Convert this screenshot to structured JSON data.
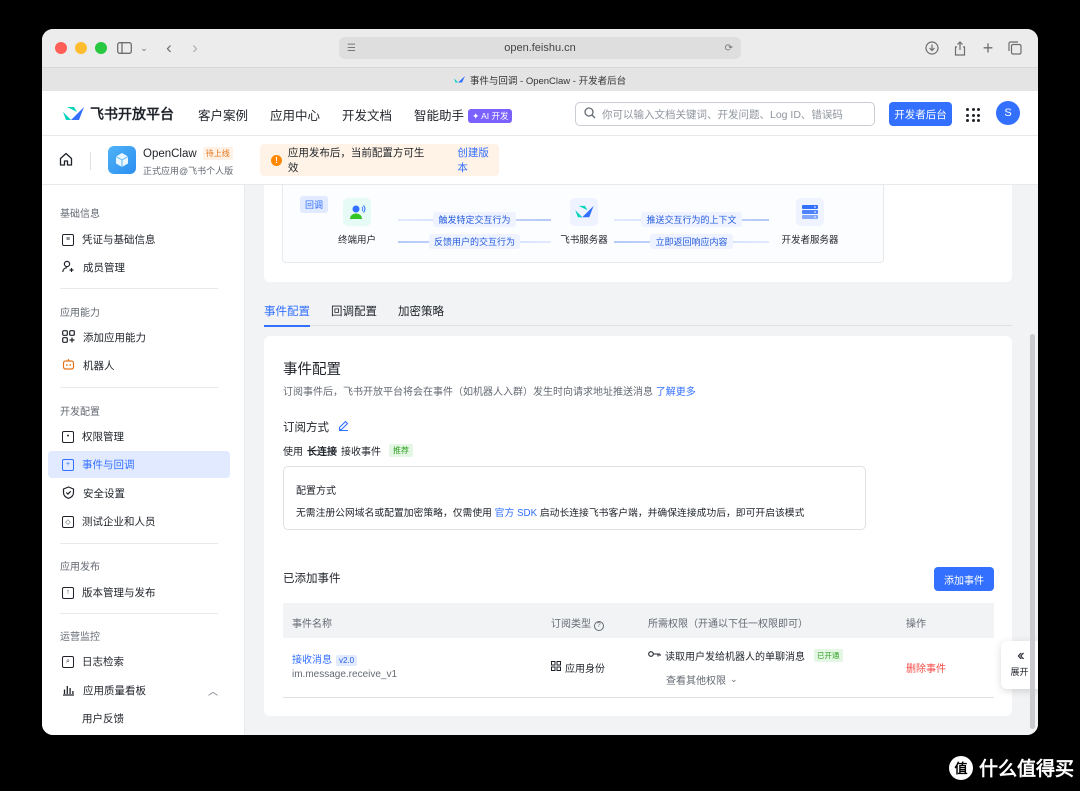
{
  "browser": {
    "url": "open.feishu.cn",
    "tab_title": "事件与回调 - OpenClaw - 开发者后台"
  },
  "topnav": {
    "brand": "飞书开放平台",
    "links": [
      "客户案例",
      "应用中心",
      "开发文档",
      "智能助手"
    ],
    "ai_badge": "AI 开发",
    "search_placeholder": "你可以输入文档关键词、开发问题、Log ID、错误码",
    "dev_console": "开发者后台",
    "avatar_letter": "S"
  },
  "app": {
    "name": "OpenClaw",
    "status": "待上线",
    "subtitle": "正式应用@飞书个人版",
    "notice": "应用发布后，当前配置方可生效",
    "notice_action": "创建版本"
  },
  "sidebar": {
    "sections": [
      {
        "title": "基础信息",
        "items": [
          {
            "label": "凭证与基础信息",
            "icon": "credential-icon"
          },
          {
            "label": "成员管理",
            "icon": "member-icon"
          }
        ]
      },
      {
        "title": "应用能力",
        "items": [
          {
            "label": "添加应用能力",
            "icon": "add-ability-icon"
          },
          {
            "label": "机器人",
            "icon": "robot-icon"
          }
        ]
      },
      {
        "title": "开发配置",
        "items": [
          {
            "label": "权限管理",
            "icon": "permission-icon"
          },
          {
            "label": "事件与回调",
            "icon": "event-icon",
            "active": true
          },
          {
            "label": "安全设置",
            "icon": "shield-icon"
          },
          {
            "label": "测试企业和人员",
            "icon": "test-icon"
          }
        ]
      },
      {
        "title": "应用发布",
        "items": [
          {
            "label": "版本管理与发布",
            "icon": "publish-icon"
          }
        ]
      },
      {
        "title": "运营监控",
        "items": [
          {
            "label": "日志检索",
            "icon": "log-icon"
          },
          {
            "label": "应用质量看板",
            "icon": "chart-icon"
          },
          {
            "label": "用户反馈",
            "icon": ""
          }
        ]
      }
    ]
  },
  "flow": {
    "tag": "回调",
    "end_user": "终端用户",
    "feishu_server": "飞书服务器",
    "dev_server": "开发者服务器",
    "arrow1": "触发特定交互行为",
    "arrow2": "反馈用户的交互行为",
    "arrow3": "推送交互行为的上下文",
    "arrow4": "立即返回响应内容"
  },
  "tabs": [
    "事件配置",
    "回调配置",
    "加密策略"
  ],
  "event_config": {
    "title": "事件配置",
    "desc": "订阅事件后，飞书开放平台将会在事件（如机器人入群）发生时向请求地址推送消息",
    "learn_more": "了解更多",
    "subscribe_title": "订阅方式",
    "use_prefix": "使用",
    "use_mode": "长连接",
    "use_suffix": "接收事件",
    "recommended": "推荐",
    "config_title": "配置方式",
    "config_desc_1": "无需注册公网域名或配置加密策略，仅需使用",
    "config_link": "官方 SDK",
    "config_desc_2": "启动长连接飞书客户端，并确保连接成功后，即可开启该模式",
    "added_title": "已添加事件",
    "add_button": "添加事件"
  },
  "table": {
    "headers": [
      "事件名称",
      "订阅类型",
      "所需权限（开通以下任一权限即可）",
      "操作"
    ],
    "rows": [
      {
        "name": "接收消息",
        "version": "v2.0",
        "key": "im.message.receive_v1",
        "sub_type": "应用身份",
        "permission": "读取用户发给机器人的单聊消息",
        "permission_status": "已开通",
        "more_permissions": "查看其他权限",
        "action": "删除事件"
      }
    ]
  },
  "expand": {
    "label": "展开"
  },
  "watermark": {
    "icon_text": "值",
    "text": "什么值得买"
  }
}
